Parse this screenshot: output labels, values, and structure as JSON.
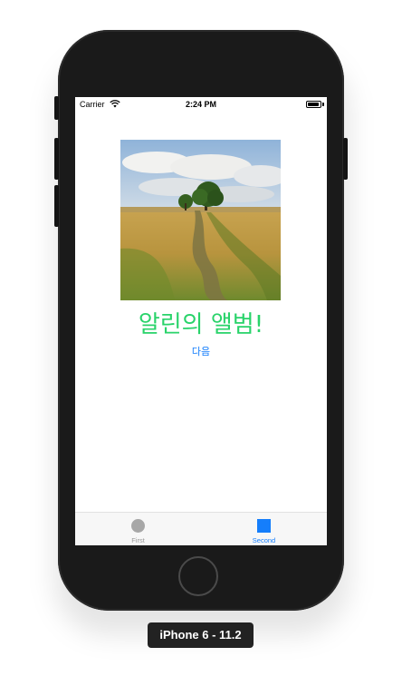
{
  "status_bar": {
    "carrier": "Carrier",
    "time": "2:24 PM",
    "battery_level": 0.9
  },
  "content": {
    "image_icon": "landscape-photo",
    "title": "알린의 앨범!",
    "next_label": "다음",
    "title_color": "#29d36a",
    "link_color": "#157efb"
  },
  "tab_bar": {
    "tabs": [
      {
        "label": "First",
        "icon": "circle-icon",
        "selected": false
      },
      {
        "label": "Second",
        "icon": "square-icon",
        "selected": true
      }
    ],
    "accent_color": "#157efb"
  },
  "simulator": {
    "device_label": "iPhone 6 - 11.2"
  }
}
